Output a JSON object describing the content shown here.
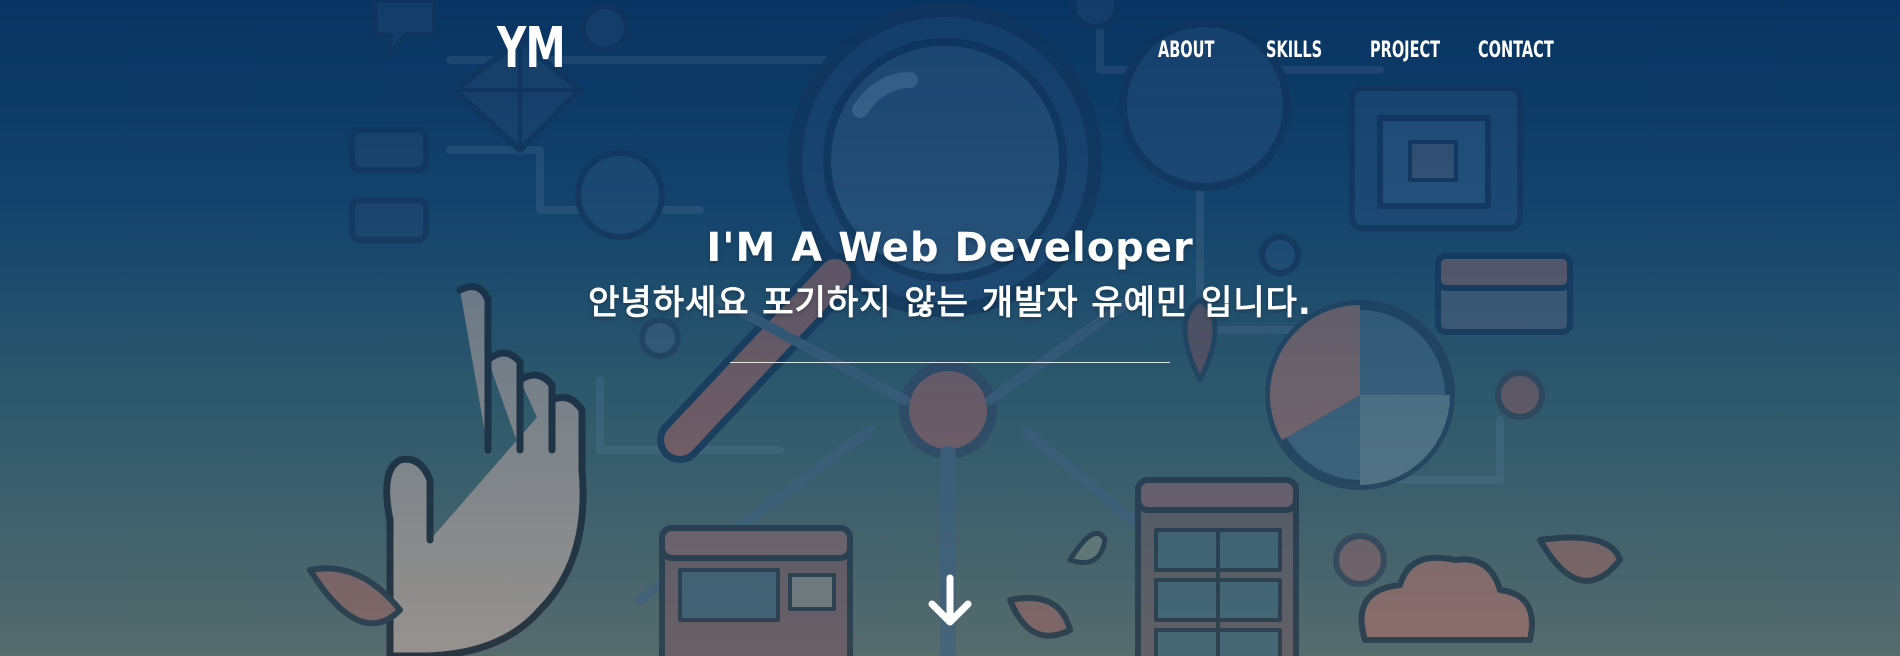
{
  "header": {
    "logo": "YM",
    "nav": [
      {
        "label": "ABOUT"
      },
      {
        "label": "SKILLS"
      },
      {
        "label": "PROJECT"
      },
      {
        "label": "CONTACT"
      }
    ]
  },
  "hero": {
    "headline": "I'M A Web Developer",
    "subline": "안녕하세요 포기하지 않는 개발자 유예민 입니다.",
    "scroll_icon": "arrow-down-icon",
    "background_icon": "tech-illustration"
  },
  "colors": {
    "text": "#ffffff",
    "bg_top": "#0c3a66",
    "bg_bottom": "#5f7270",
    "accent_salmon": "#b8746a",
    "accent_teal": "#3e6e7a"
  }
}
